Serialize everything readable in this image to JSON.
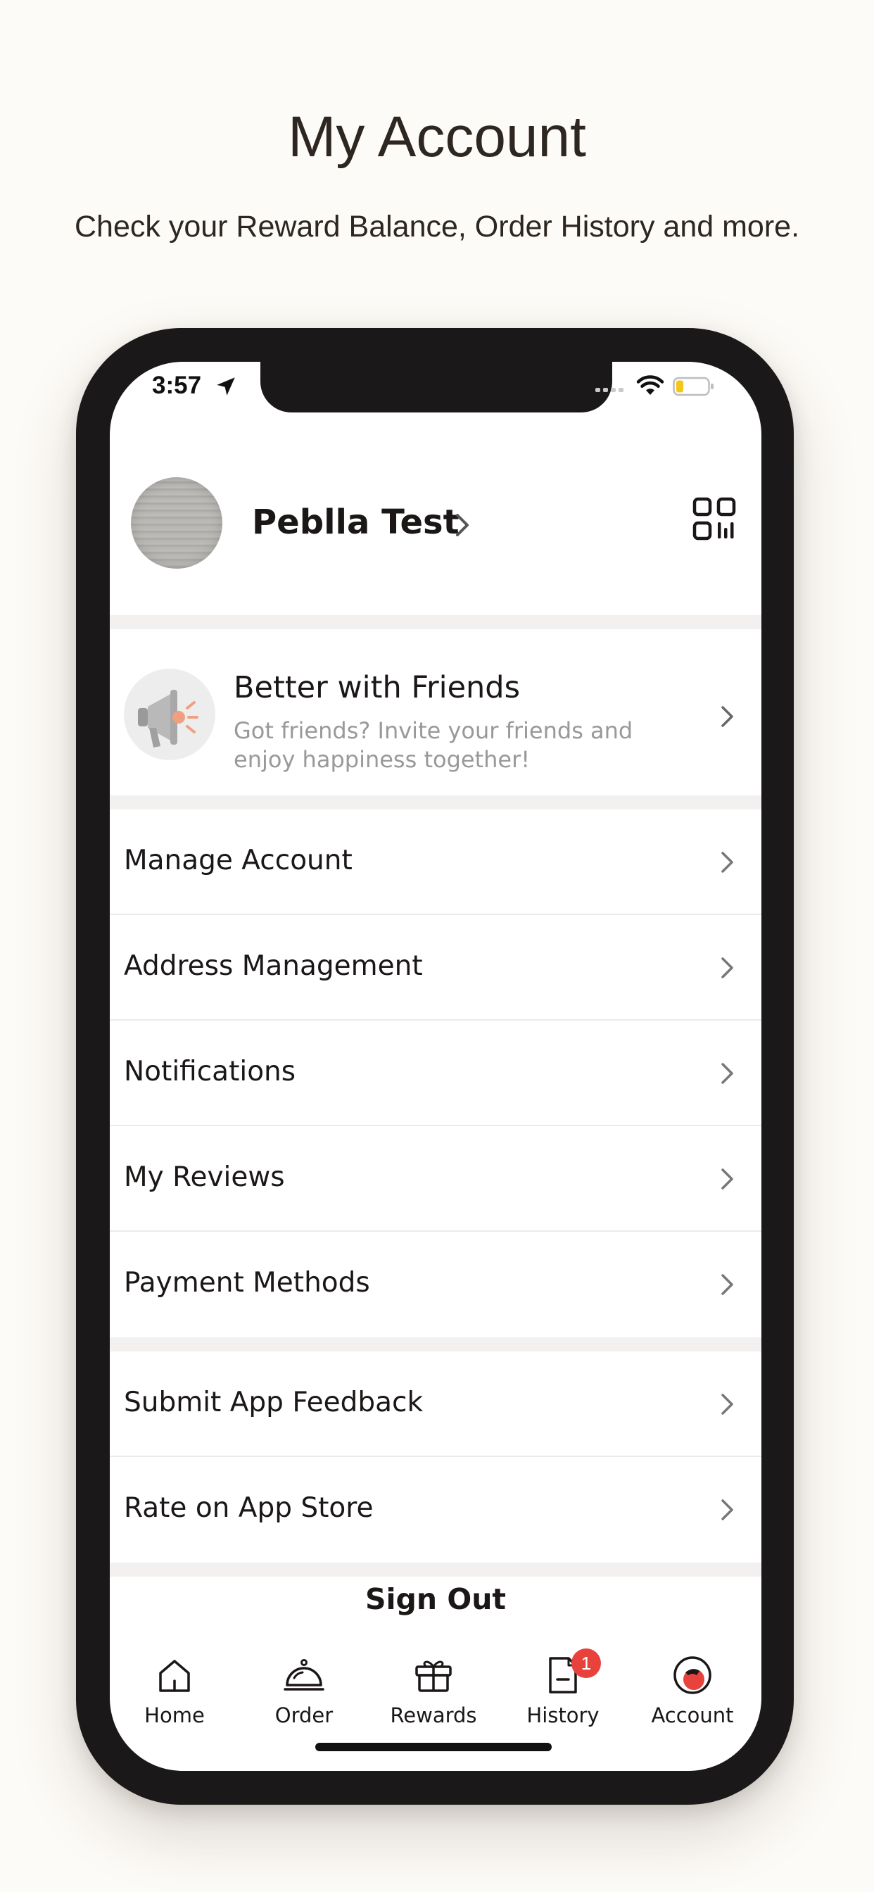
{
  "promo": {
    "title": "My Account",
    "subtitle": "Check your Reward Balance, Order History and more."
  },
  "status_bar": {
    "time": "3:57",
    "icons": [
      "location-arrow-icon",
      "signal-icon",
      "wifi-icon",
      "battery-icon"
    ],
    "battery_color": "#f5c518"
  },
  "profile": {
    "name": "Peblla Test",
    "avatar_icon": "avatar",
    "qr_icon": "qr-code-icon"
  },
  "invite": {
    "title": "Better with Friends",
    "description": "Got friends? Invite your friends and enjoy happiness together!",
    "icon": "megaphone-icon",
    "accent_color": "#f0a080"
  },
  "menu_group_1": [
    {
      "label": "Manage Account"
    },
    {
      "label": "Address Management"
    },
    {
      "label": "Notifications"
    },
    {
      "label": "My Reviews"
    },
    {
      "label": "Payment Methods"
    }
  ],
  "menu_group_2": [
    {
      "label": "Submit App Feedback"
    },
    {
      "label": "Rate on App Store"
    }
  ],
  "sign_out": "Sign Out",
  "tabs": [
    {
      "label": "Home",
      "icon": "home-icon"
    },
    {
      "label": "Order",
      "icon": "cloche-icon"
    },
    {
      "label": "Rewards",
      "icon": "gift-icon"
    },
    {
      "label": "History",
      "icon": "document-icon",
      "badge": "1"
    },
    {
      "label": "Account",
      "icon": "account-icon",
      "active": true
    }
  ],
  "colors": {
    "background": "#fdfbf7",
    "badge": "#e8423c",
    "text": "#1b1717",
    "muted": "#9a9898"
  }
}
